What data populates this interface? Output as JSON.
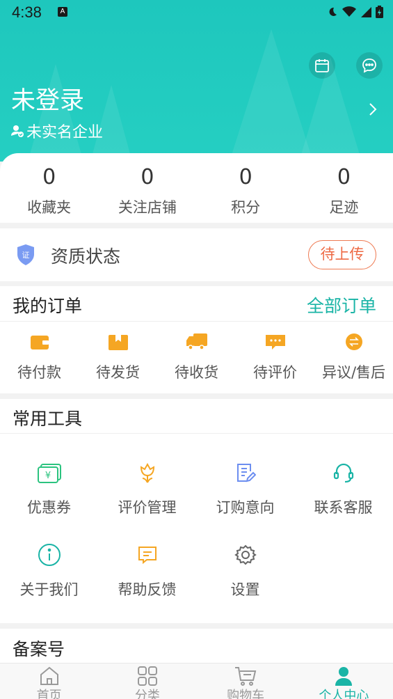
{
  "status_bar": {
    "time": "4:38",
    "notification_badge": "A"
  },
  "header": {
    "user_name": "未登录",
    "verify_status": "未实名企业",
    "calendar_icon": "calendar-icon",
    "message_icon": "message-icon"
  },
  "stats": [
    {
      "value": "0",
      "label": "收藏夹"
    },
    {
      "value": "0",
      "label": "关注店铺"
    },
    {
      "value": "0",
      "label": "积分"
    },
    {
      "value": "0",
      "label": "足迹"
    }
  ],
  "qualification": {
    "label": "资质状态",
    "button": "待上传",
    "badge_text": "证"
  },
  "orders": {
    "title": "我的订单",
    "all_link": "全部订单",
    "items": [
      {
        "label": "待付款",
        "icon": "wallet-icon"
      },
      {
        "label": "待发货",
        "icon": "package-icon"
      },
      {
        "label": "待收货",
        "icon": "truck-icon"
      },
      {
        "label": "待评价",
        "icon": "comment-icon"
      },
      {
        "label": "异议/售后",
        "icon": "exchange-icon"
      }
    ]
  },
  "tools": {
    "title": "常用工具",
    "items": [
      {
        "label": "优惠券",
        "icon": "coupon-icon"
      },
      {
        "label": "评价管理",
        "icon": "flower-icon"
      },
      {
        "label": "订购意向",
        "icon": "edit-doc-icon"
      },
      {
        "label": "联系客服",
        "icon": "headset-icon"
      },
      {
        "label": "关于我们",
        "icon": "info-icon"
      },
      {
        "label": "帮助反馈",
        "icon": "feedback-icon"
      },
      {
        "label": "设置",
        "icon": "gear-icon"
      }
    ]
  },
  "beian": {
    "title": "备案号"
  },
  "tabbar": {
    "items": [
      {
        "label": "首页",
        "icon": "home-icon"
      },
      {
        "label": "分类",
        "icon": "grid-icon"
      },
      {
        "label": "购物车",
        "icon": "cart-icon"
      },
      {
        "label": "个人中心",
        "icon": "user-icon"
      }
    ],
    "active": "个人中心"
  },
  "colors": {
    "brand": "#1ec7bd",
    "accent_text": "#1ab4a6",
    "orange": "#f5a623",
    "upload_button": "#ee6a44"
  }
}
